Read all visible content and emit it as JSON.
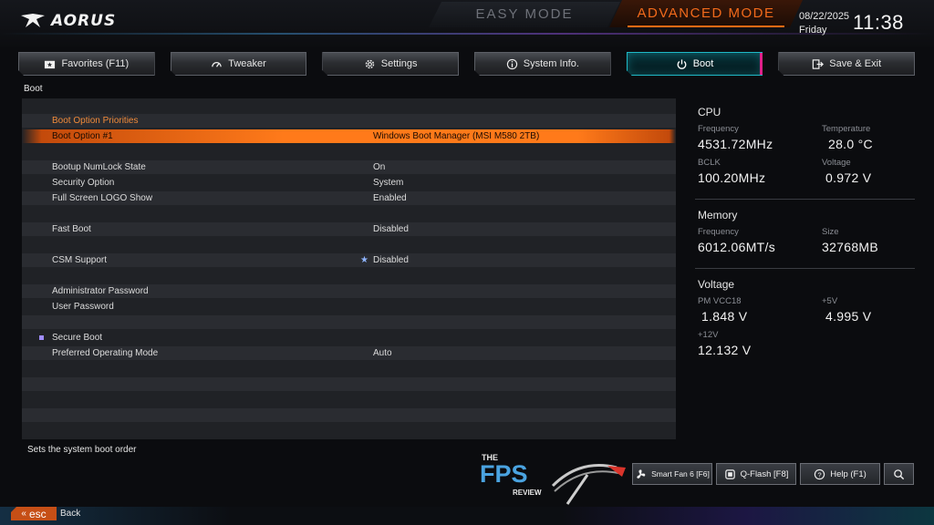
{
  "header": {
    "logo_text": "AORUS",
    "easy_mode_label": "EASY MODE",
    "advanced_mode_label": "ADVANCED MODE",
    "date": "08/22/2025",
    "weekday": "Friday",
    "time": "11:38"
  },
  "tabs": [
    {
      "label": "Favorites (F11)",
      "icon": "favorites-icon"
    },
    {
      "label": "Tweaker",
      "icon": "speedometer-icon"
    },
    {
      "label": "Settings",
      "icon": "gear-icon"
    },
    {
      "label": "System Info.",
      "icon": "info-icon"
    },
    {
      "label": "Boot",
      "icon": "power-icon",
      "active": true
    },
    {
      "label": "Save & Exit",
      "icon": "exit-icon"
    }
  ],
  "breadcrumb": "Boot",
  "boot_list": {
    "section_header": "Boot Option Priorities",
    "boot_option_1": {
      "label": "Boot Option #1",
      "value": "Windows Boot Manager (MSI M580 2TB)"
    },
    "numlock": {
      "label": "Bootup NumLock State",
      "value": "On"
    },
    "security_option": {
      "label": "Security Option",
      "value": "System"
    },
    "full_screen_logo": {
      "label": "Full Screen LOGO Show",
      "value": "Enabled"
    },
    "fast_boot": {
      "label": "Fast Boot",
      "value": "Disabled"
    },
    "csm_support": {
      "label": "CSM Support",
      "value": "Disabled"
    },
    "admin_password": {
      "label": "Administrator Password"
    },
    "user_password": {
      "label": "User Password"
    },
    "secure_boot": {
      "label": "Secure Boot"
    },
    "preferred_mode": {
      "label": "Preferred Operating Mode",
      "value": "Auto"
    }
  },
  "help_text": "Sets the system boot order",
  "info_panel": {
    "cpu": {
      "title": "CPU",
      "frequency_label": "Frequency",
      "frequency_value": "4531.72MHz",
      "temperature_label": "Temperature",
      "temperature_value": "28.0 °C",
      "bclk_label": "BCLK",
      "bclk_value": "100.20MHz",
      "voltage_label": "Voltage",
      "voltage_value": "0.972 V"
    },
    "memory": {
      "title": "Memory",
      "frequency_label": "Frequency",
      "frequency_value": "6012.06MT/s",
      "size_label": "Size",
      "size_value": "32768MB"
    },
    "voltage": {
      "title": "Voltage",
      "pm_vcc18_label": "PM VCC18",
      "pm_vcc18_value": "1.848 V",
      "v5_label": "+5V",
      "v5_value": "4.995 V",
      "v12_label": "+12V",
      "v12_value": "12.132 V"
    }
  },
  "watermark": {
    "top": "THE",
    "main": "FPS",
    "bottom": "REVIEW"
  },
  "bottom_buttons": {
    "smart_fan": "Smart Fan 6 [F6]",
    "qflash": "Q-Flash [F8]",
    "help": "Help (F1)"
  },
  "esc": {
    "key_label": "esc",
    "action_label": "Back"
  },
  "colors": {
    "accent_orange": "#ff7a1a",
    "active_tab_cyan": "#1fb9c6",
    "active_tab_magenta": "#e0208a"
  }
}
